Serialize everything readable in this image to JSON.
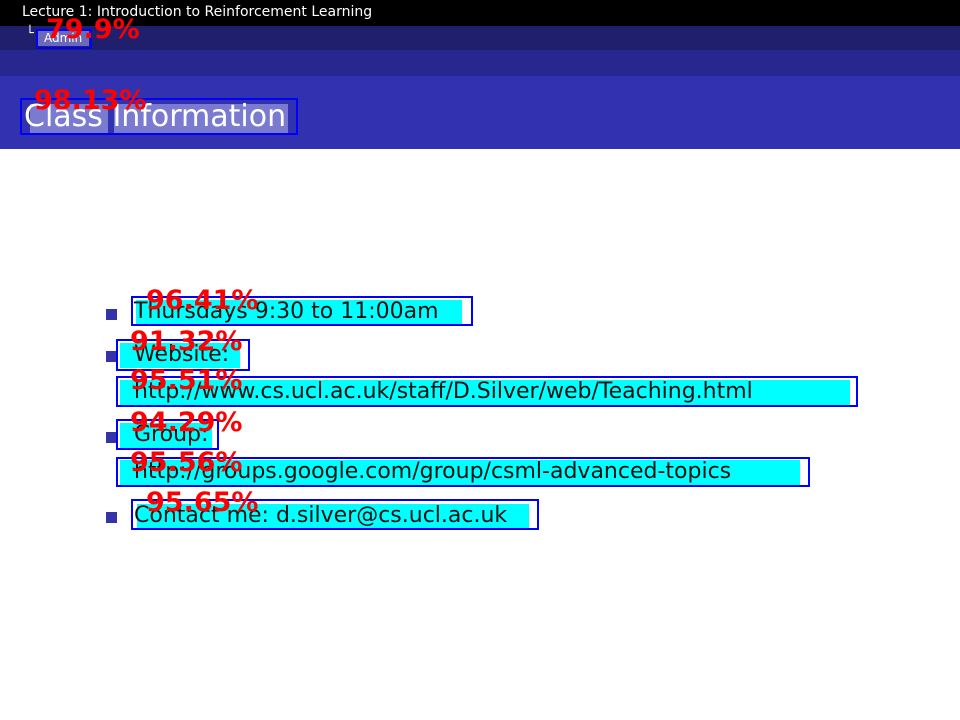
{
  "header": {
    "lecture_title": "Lecture 1: Introduction to Reinforcement Learning",
    "section_prefix": "└",
    "section": "Admin"
  },
  "frame": {
    "title": "Class Information"
  },
  "body": {
    "schedule": "Thursdays 9:30 to 11:00am",
    "website_label": "Website:",
    "website_url": "http://www.cs.ucl.ac.uk/staff/D.Silver/web/Teaching.html",
    "group_label": "Group:",
    "group_url": "http://groups.google.com/group/csml-advanced-topics",
    "contact": "Contact me: d.silver@cs.ucl.ac.uk"
  },
  "detections": [
    {
      "target": "section",
      "confidence": "79.9%"
    },
    {
      "target": "title",
      "confidence": "98.13%"
    },
    {
      "target": "schedule",
      "confidence": "96.41%"
    },
    {
      "target": "website_label",
      "confidence": "91.32%"
    },
    {
      "target": "website_url",
      "confidence": "95.51%"
    },
    {
      "target": "group_label",
      "confidence": "94.29%"
    },
    {
      "target": "group_url",
      "confidence": "95.56%"
    },
    {
      "target": "contact",
      "confidence": "95.65%"
    }
  ],
  "colors": {
    "header_black": "#000000",
    "nav_navy": "#1f1f6e",
    "frametitle_blue": "#3232b0",
    "bullet": "#3434a8",
    "highlight": "#00ffff",
    "box": "#0000ff",
    "confidence_text": "#ff0000"
  }
}
